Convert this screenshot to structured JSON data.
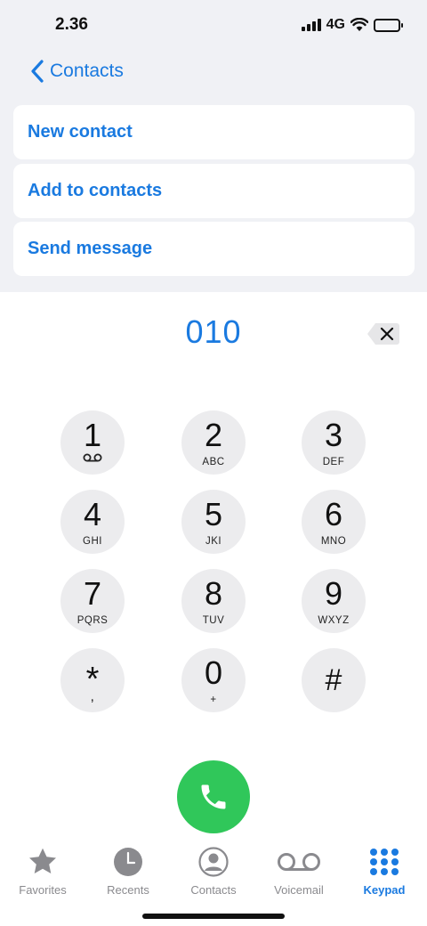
{
  "status": {
    "time": "2.36",
    "network": "4G"
  },
  "header": {
    "back_label": "Contacts"
  },
  "actions": [
    {
      "label": "New contact"
    },
    {
      "label": "Add to contacts"
    },
    {
      "label": "Send message"
    }
  ],
  "dialer": {
    "number": "010",
    "keys": [
      {
        "digit": "1",
        "letters": ""
      },
      {
        "digit": "2",
        "letters": "ABC"
      },
      {
        "digit": "3",
        "letters": "DEF"
      },
      {
        "digit": "4",
        "letters": "GHI"
      },
      {
        "digit": "5",
        "letters": "JKI"
      },
      {
        "digit": "6",
        "letters": "MNO"
      },
      {
        "digit": "7",
        "letters": "PQRS"
      },
      {
        "digit": "8",
        "letters": "TUV"
      },
      {
        "digit": "9",
        "letters": "WXYZ"
      },
      {
        "digit": "*",
        "letters": ","
      },
      {
        "digit": "0",
        "letters": "+"
      },
      {
        "digit": "#",
        "letters": ""
      }
    ]
  },
  "tabs": [
    {
      "label": "Favorites",
      "icon": "star-icon"
    },
    {
      "label": "Recents",
      "icon": "clock-icon"
    },
    {
      "label": "Contacts",
      "icon": "person-icon"
    },
    {
      "label": "Voicemail",
      "icon": "voicemail-icon"
    },
    {
      "label": "Keypad",
      "icon": "keypad-icon",
      "active": true
    }
  ],
  "colors": {
    "accent": "#1a7ae0",
    "call": "#30c75a",
    "key_bg": "#ececee",
    "inactive": "#8a8a8e"
  }
}
